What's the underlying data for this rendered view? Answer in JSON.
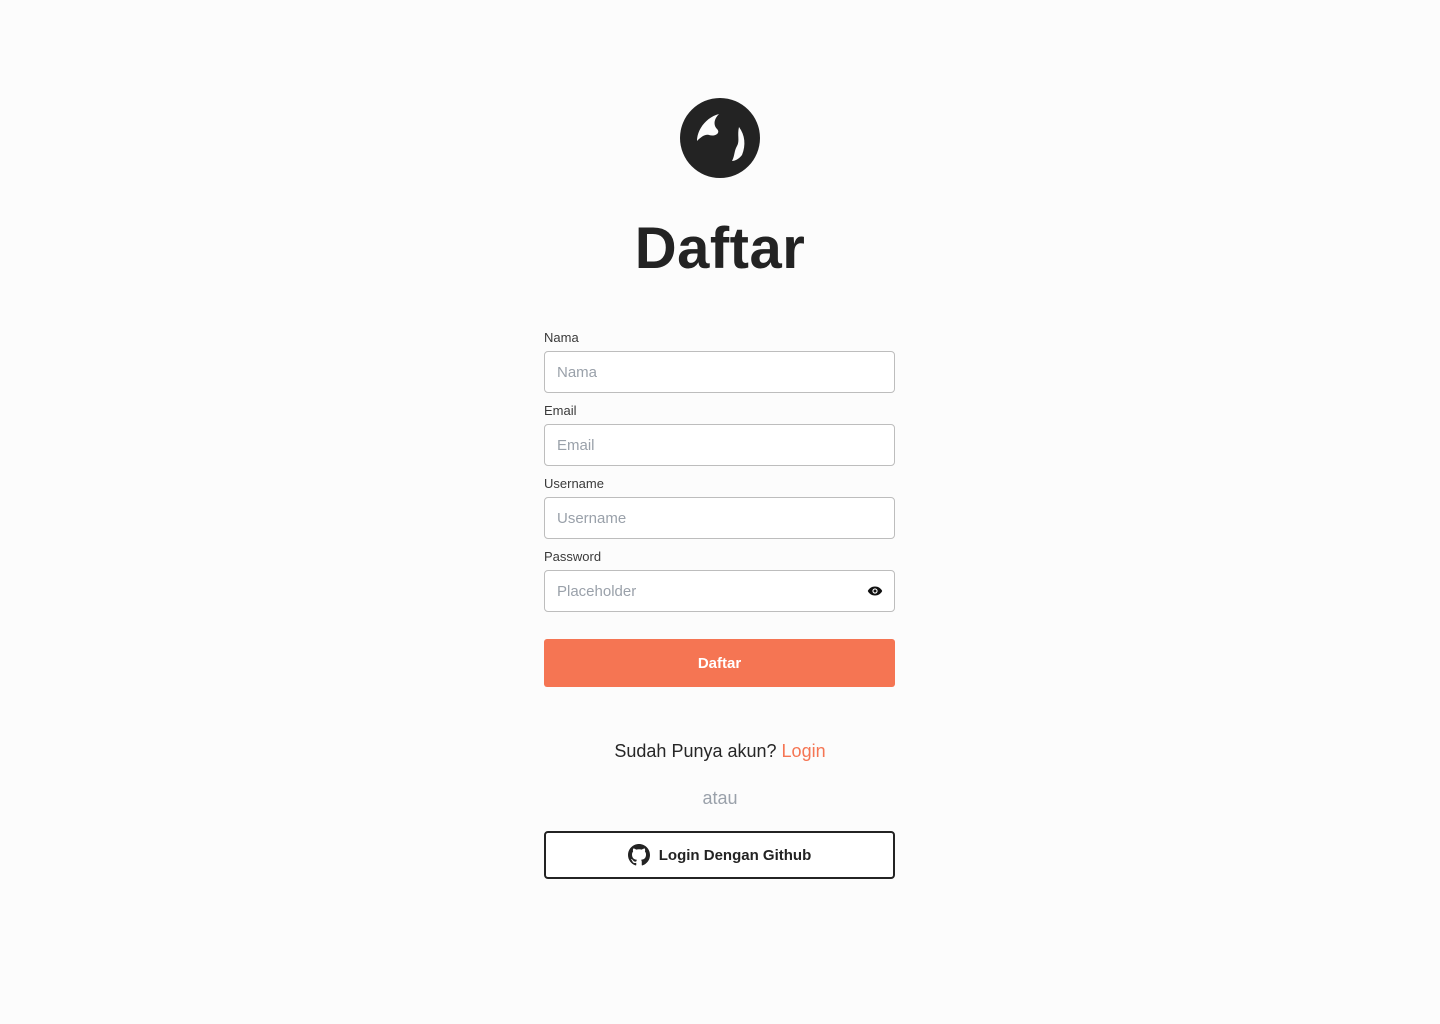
{
  "header": {
    "logo_icon": "globe-icon",
    "title": "Daftar"
  },
  "form": {
    "fields": [
      {
        "label": "Nama",
        "placeholder": "Nama",
        "value": ""
      },
      {
        "label": "Email",
        "placeholder": "Email",
        "value": ""
      },
      {
        "label": "Username",
        "placeholder": "Username",
        "value": ""
      },
      {
        "label": "Password",
        "placeholder": "Placeholder",
        "value": "",
        "toggle_icon": "eye-icon"
      }
    ],
    "submit_label": "Daftar"
  },
  "footer": {
    "have_account_text": "Sudah Punya akun?",
    "login_link": "Login",
    "separator": "atau",
    "github_label": "Login Dengan Github",
    "github_icon": "github-icon"
  },
  "colors": {
    "accent": "#f57553",
    "text": "#232323",
    "muted": "#9aa1aa",
    "border": "#bdbdbd",
    "background": "#fcfcfc"
  }
}
